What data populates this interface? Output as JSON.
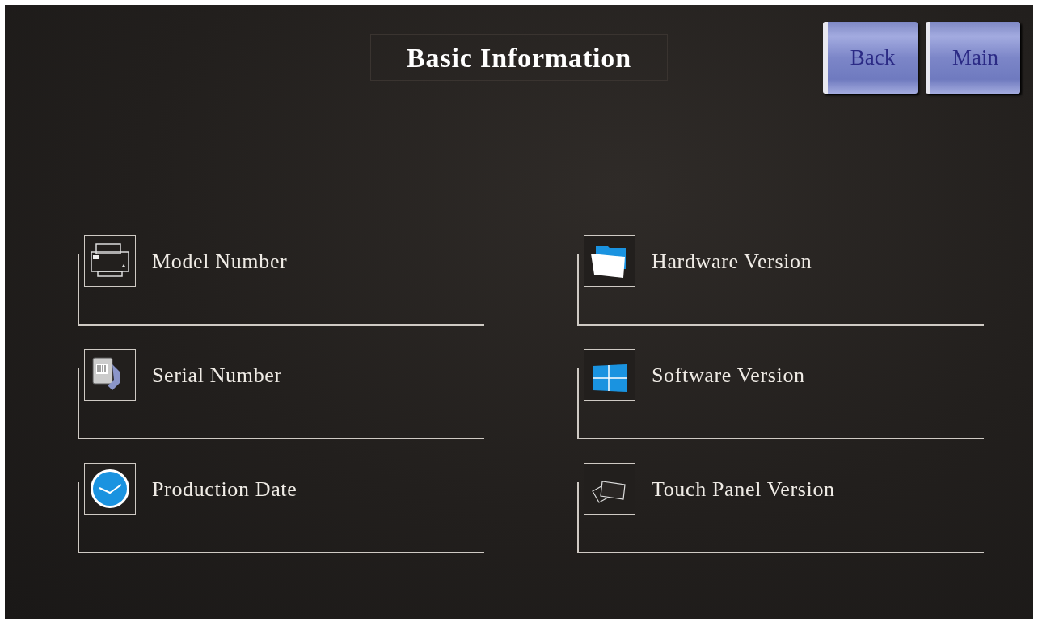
{
  "title": "Basic Information",
  "buttons": [
    {
      "label": "Back"
    },
    {
      "label": "Main"
    }
  ],
  "columns": [
    [
      {
        "kind": "printer",
        "label": "Model Number"
      },
      {
        "kind": "document",
        "label": "Serial Number"
      },
      {
        "kind": "clock",
        "label": "Production Date"
      }
    ],
    [
      {
        "kind": "folder",
        "label": "Hardware Version"
      },
      {
        "kind": "windows",
        "label": "Software Version"
      },
      {
        "kind": "panels",
        "label": "Touch Panel Version"
      }
    ]
  ]
}
